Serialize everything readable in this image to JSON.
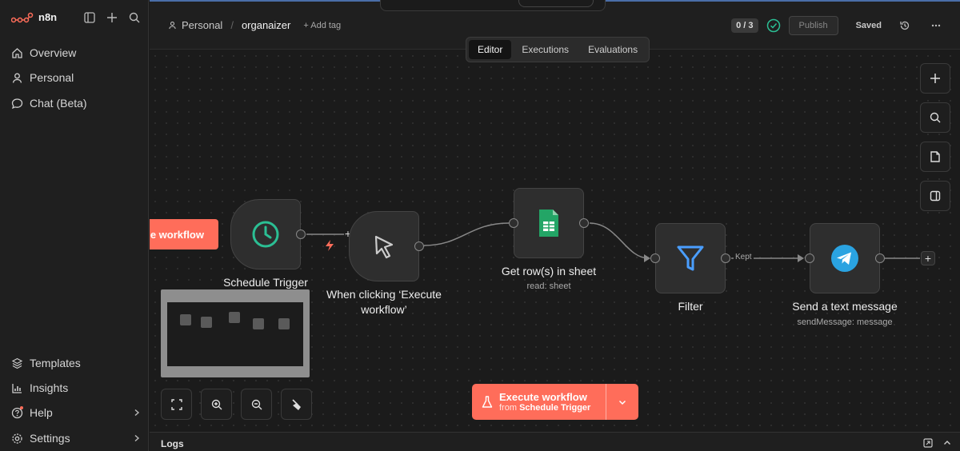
{
  "app": {
    "name": "n8n"
  },
  "sidebar": {
    "top_items": [
      {
        "label": "Overview",
        "icon": "home-icon"
      },
      {
        "label": "Personal",
        "icon": "user-icon"
      },
      {
        "label": "Chat (Beta)",
        "icon": "chat-icon"
      }
    ],
    "bottom_items": [
      {
        "label": "Templates",
        "icon": "templates-icon"
      },
      {
        "label": "Insights",
        "icon": "insights-icon"
      },
      {
        "label": "Help",
        "icon": "help-icon"
      },
      {
        "label": "Settings",
        "icon": "settings-icon"
      }
    ]
  },
  "header": {
    "breadcrumb_project": "Personal",
    "workflow_name": "organaizer",
    "add_tag": "+ Add tag",
    "counter": "0 / 3",
    "publish_label": "Publish",
    "saved_label": "Saved"
  },
  "tabs": [
    {
      "label": "Editor",
      "active": true
    },
    {
      "label": "Executions",
      "active": false
    },
    {
      "label": "Evaluations",
      "active": false
    }
  ],
  "canvas": {
    "partial_button": "e workflow",
    "nodes": [
      {
        "id": "schedule",
        "label": "Schedule Trigger",
        "subtitle": "",
        "icon": "clock-icon"
      },
      {
        "id": "manual",
        "label": "When clicking ‘Execute workflow’",
        "subtitle": "",
        "icon": "cursor-icon"
      },
      {
        "id": "sheets",
        "label": "Get row(s) in sheet",
        "subtitle": "read: sheet",
        "icon": "google-sheets-icon"
      },
      {
        "id": "filter",
        "label": "Filter",
        "subtitle": "",
        "icon": "filter-icon"
      },
      {
        "id": "telegram",
        "label": "Send a text message",
        "subtitle": "sendMessage: message",
        "icon": "telegram-icon"
      }
    ],
    "edge_label_kept": "Kept",
    "execute_button": {
      "title": "Execute workflow",
      "prefix": "from",
      "source": "Schedule Trigger"
    }
  },
  "logs": {
    "label": "Logs"
  },
  "colors": {
    "accent": "#ff6d5a",
    "sheets_green": "#23a566",
    "telegram_blue": "#2aa3e1",
    "filter_blue": "#4a9eff",
    "clock_teal": "#2bbf94"
  }
}
